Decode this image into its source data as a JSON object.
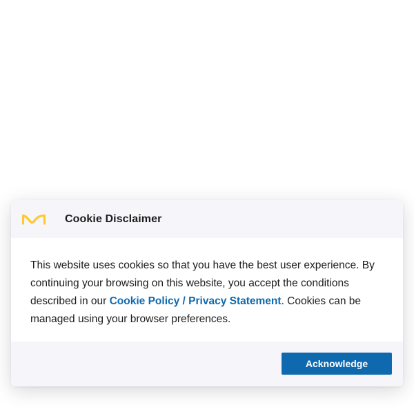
{
  "dialog": {
    "logo_icon": "merck-m-logo-icon",
    "title": "Cookie Disclaimer",
    "body": {
      "text_before_link": "This website uses cookies so that you have the best user experience. By continuing your browsing on this website, you accept the conditions described in our ",
      "link_text": "Cookie Policy / Privacy Statement",
      "text_after_link": ". Cookies can be managed using your browser preferences."
    },
    "acknowledge_label": "Acknowledge"
  },
  "colors": {
    "link": "#0f69af",
    "button_bg": "#0f69af",
    "panel_bg": "#f6f6fa",
    "logo": "#ffc832"
  }
}
